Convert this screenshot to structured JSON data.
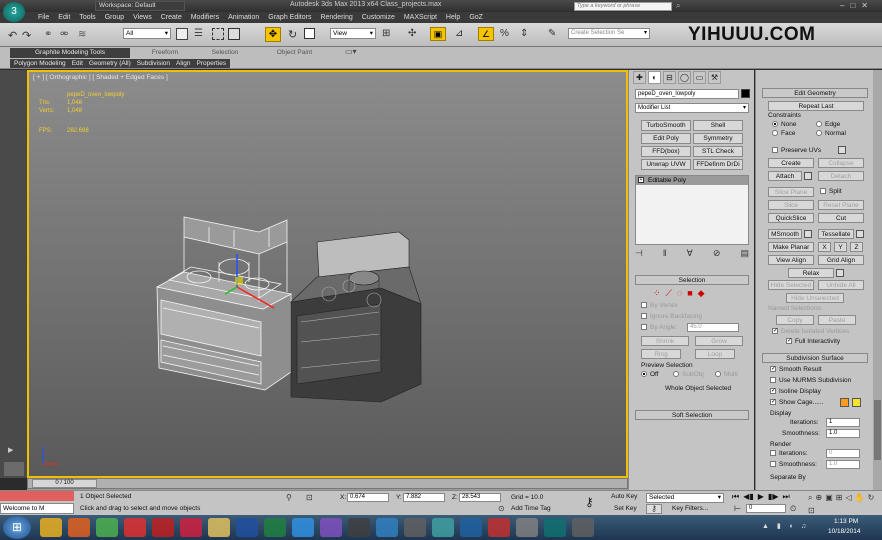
{
  "window": {
    "title": "Autodesk 3ds Max  2013 x64     Class_projects.max",
    "workspace": "Workspace: Default",
    "search_placeholder": "Type a keyword or phrase"
  },
  "menu": [
    "File",
    "Edit",
    "Tools",
    "Group",
    "Views",
    "Create",
    "Modifiers",
    "Animation",
    "Graph Editors",
    "Rendering",
    "Customize",
    "MAXScript",
    "Help",
    "GoZ"
  ],
  "toolbar": {
    "selection_filter": "All",
    "ref_coord": "View",
    "named_selection": "Create Selection Se"
  },
  "watermark": "YIHUUU.COM",
  "ribbon": {
    "tabs": [
      "Graphite Modeling Tools",
      "Freeform",
      "Selection",
      "Object Paint"
    ],
    "sub": [
      "Polygon Modeling",
      "Edit",
      "Geometry (All)",
      "Subdivision",
      "Align",
      "Properties"
    ]
  },
  "viewport": {
    "label": "[ + ] [ Orthographic ] [ Shaded + Edged Faces ]",
    "stats": {
      "name": "pepeD_oven_lowpoly",
      "tris_label": "Tris:",
      "tris": "1,048",
      "verts_label": "Verts:",
      "verts": "1,048",
      "fps_label": "FPS:",
      "fps": "282.698"
    }
  },
  "cmd": {
    "object_name": "pepeD_oven_lowpoly",
    "modifier_list": "Modifier List",
    "mod_buttons": [
      "TurboSmooth",
      "Shell",
      "Edit Poly",
      "Symmetry",
      "FFD(box)",
      "STL Check",
      "Unwrap UVW",
      "FFDefinm DrDi"
    ],
    "stack_item": "Editable Poly",
    "selection_hd": "Selection",
    "sel_by_vertex": "By Vertex",
    "ignore_backfacing": "Ignore Backfacing",
    "by_angle": "By Angle:",
    "by_angle_val": "45.0",
    "shrink": "Shrink",
    "grow": "Grow",
    "ring": "Ring",
    "loop": "Loop",
    "preview_sel": "Preview Selection",
    "preview_opts": [
      "Off",
      "SubObj",
      "Multi"
    ],
    "whole_obj": "Whole Object Selected",
    "soft_sel": "Soft Selection"
  },
  "edit_geom": {
    "header": "Edit Geometry",
    "repeat_last": "Repeat Last",
    "constraints": "Constraints",
    "c_none": "None",
    "c_edge": "Edge",
    "c_face": "Face",
    "c_normal": "Normal",
    "preserve_uvs": "Preserve UVs",
    "create": "Create",
    "collapse": "Collapse",
    "attach": "Attach",
    "detach": "Detach",
    "slice_plane": "Slice Plane",
    "split": "Split",
    "slice": "Slice",
    "reset_plane": "Reset Plane",
    "quickslice": "QuickSlice",
    "cut": "Cut",
    "msmooth": "MSmooth",
    "tessellate": "Tessellate",
    "make_planar": "Make Planar",
    "x": "X",
    "y": "Y",
    "z": "Z",
    "view_align": "View Align",
    "grid_align": "Grid Align",
    "relax": "Relax",
    "hide_sel": "Hide Selected",
    "unhide_all": "Unhide All",
    "hide_unsel": "Hide Unselected",
    "named_sel": "Named Selections:",
    "copy": "Copy",
    "paste": "Paste",
    "delete_iso": "Delete Isolated Vertices",
    "full_inter": "Full Interactivity"
  },
  "subdiv": {
    "header": "Subdivision Surface",
    "smooth_result": "Smooth Result",
    "use_nurms": "Use NURMS Subdivision",
    "isoline": "Isoline Display",
    "show_cage": "Show Cage......",
    "display": "Display",
    "iterations": "Iterations:",
    "iter_val": "1",
    "smoothness": "Smoothness:",
    "smooth_val": "1.0",
    "render": "Render",
    "r_iter_val": "0",
    "r_smooth_val": "1.0",
    "separate_by": "Separate By"
  },
  "status": {
    "timeline": "0 / 100",
    "selected": "1 Object Selected",
    "prompt": "Click and drag to select and move objects",
    "x_label": "X:",
    "x": "0.674",
    "y_label": "Y:",
    "y": "7.882",
    "z_label": "Z:",
    "z": "28.543",
    "grid": "Grid = 10.0",
    "add_time_tag": "Add Time Tag",
    "autokey": "Auto Key",
    "set_key": "Set Key",
    "key_filters": "Key Filters...",
    "selected_dd": "Selected",
    "frame": "0",
    "welcome": "Welcome to M"
  },
  "taskbar": {
    "time": "1:13 PM",
    "date": "10/18/2014"
  },
  "colors": {
    "viewport_top": "#8a8a8a",
    "viewport_bottom": "#5a5a5a",
    "active_border": "#f0c000",
    "cage_orange": "#ff9b1e",
    "cage_yellow": "#f7e22a"
  }
}
